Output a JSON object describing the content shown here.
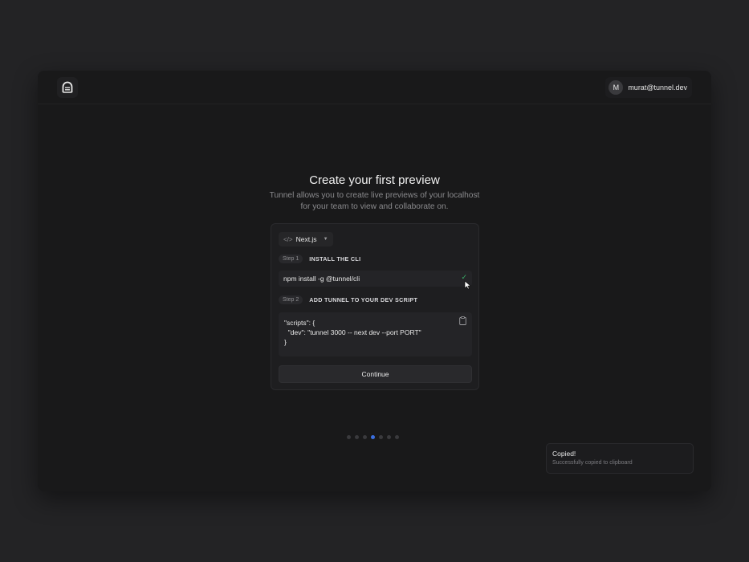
{
  "header": {
    "user_initial": "M",
    "user_email": "murat@tunnel.dev"
  },
  "hero": {
    "title": "Create your first preview",
    "subtitle_line1": "Tunnel allows you to create live previews of your localhost",
    "subtitle_line2": "for your team to view and collaborate on."
  },
  "card": {
    "framework_label": "Next.js",
    "step1": {
      "pill": "Step 1",
      "title": "INSTALL THE CLI"
    },
    "install_command": "npm install -g @tunnel/cli",
    "step2": {
      "pill": "Step 2",
      "title": "ADD TUNNEL TO YOUR DEV SCRIPT"
    },
    "script_code": "\"scripts\": {\n  \"dev\": \"tunnel 3000 -- next dev --port PORT\"\n}",
    "continue_label": "Continue"
  },
  "pagination": {
    "total": 7,
    "active_index": 3
  },
  "toast": {
    "title": "Copied!",
    "message": "Successfully copied to clipboard"
  },
  "colors": {
    "accent": "#3b6fe0",
    "success": "#3ab36a",
    "background": "#232325",
    "window": "#19191a"
  }
}
